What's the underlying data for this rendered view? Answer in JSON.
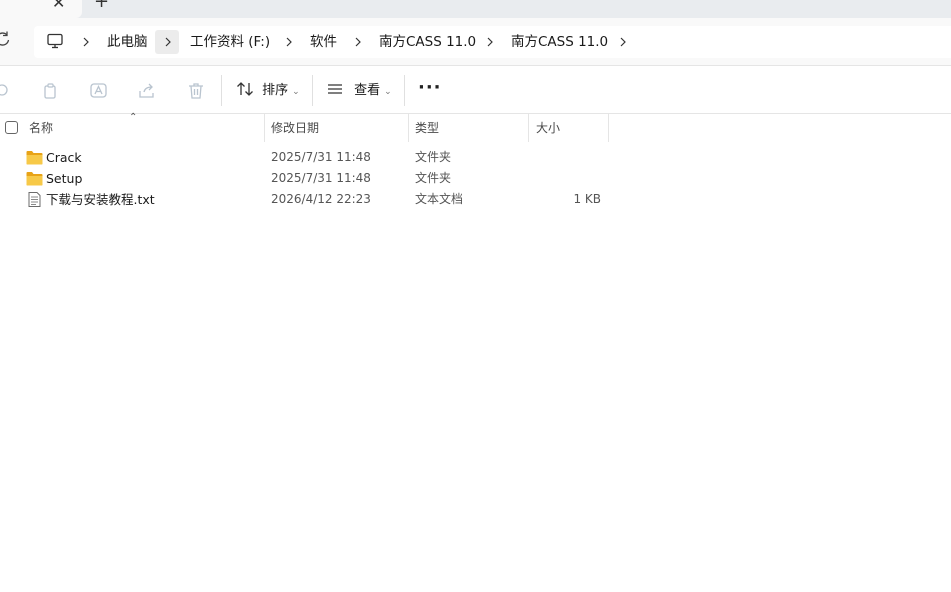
{
  "tabstrip": {
    "close_glyph": "✕",
    "new_tab_glyph": "+"
  },
  "address_bar": {
    "crumbs": [
      "此电脑",
      "工作资料 (F:)",
      "软件",
      "南方CASS 11.0",
      "南方CASS 11.0"
    ],
    "icon": "pc-icon"
  },
  "toolbar": {
    "sort_label": "排序",
    "view_label": "查看",
    "more_label": "···"
  },
  "columns": {
    "name": "名称",
    "modified": "修改日期",
    "type": "类型",
    "size": "大小"
  },
  "files": [
    {
      "name": "Crack",
      "modified": "2025/7/31 11:48",
      "type": "文件夹",
      "size": "",
      "icon": "folder-icon"
    },
    {
      "name": "Setup",
      "modified": "2025/7/31 11:48",
      "type": "文件夹",
      "size": "",
      "icon": "folder-icon"
    },
    {
      "name": "下载与安装教程.txt",
      "modified": "2026/4/12 22:23",
      "type": "文本文档",
      "size": "1 KB",
      "icon": "text-file-icon"
    }
  ],
  "colors": {
    "folder": "#f5c542",
    "accent": "#0067c0",
    "chrome": "#f9f9f9"
  }
}
